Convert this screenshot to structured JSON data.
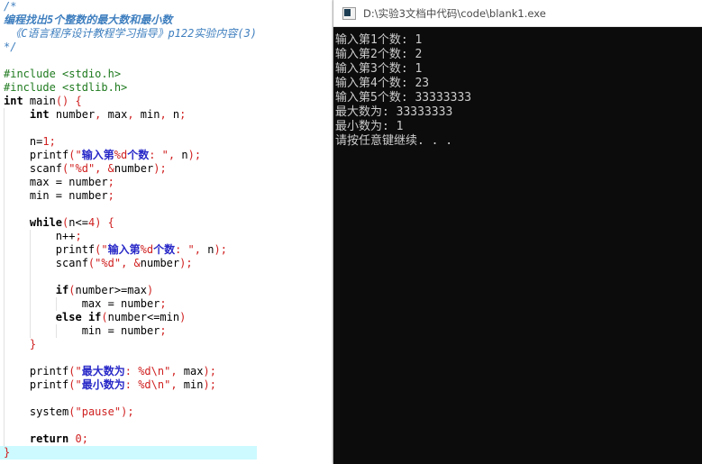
{
  "editor": {
    "language": "c",
    "highlight_color": "#ccfaff",
    "lines": [
      {
        "n": 1,
        "indent": 0,
        "tokens": [
          {
            "t": "/*",
            "c": "cmt2"
          }
        ]
      },
      {
        "n": 2,
        "indent": 0,
        "tokens": [
          {
            "t": "编程找出5个整数的最大数和最小数",
            "c": "cmt"
          }
        ]
      },
      {
        "n": 3,
        "indent": 0,
        "tokens": [
          {
            "t": " 《C语言程序设计教程学习指导》p122实验内容(3)",
            "c": "cmt2"
          }
        ]
      },
      {
        "n": 4,
        "indent": 0,
        "tokens": [
          {
            "t": "*/",
            "c": "cmt2"
          }
        ]
      },
      {
        "n": 5,
        "indent": 0,
        "tokens": []
      },
      {
        "n": 6,
        "indent": 0,
        "tokens": [
          {
            "t": "#include <stdio.h>",
            "c": "pre"
          }
        ]
      },
      {
        "n": 7,
        "indent": 0,
        "tokens": [
          {
            "t": "#include <stdlib.h>",
            "c": "pre"
          }
        ]
      },
      {
        "n": 8,
        "indent": 0,
        "tokens": [
          {
            "t": "int",
            "c": "kw"
          },
          {
            "t": " main",
            "c": "fn"
          },
          {
            "t": "()",
            "c": "op"
          },
          {
            "t": " ",
            "c": "pl"
          },
          {
            "t": "{",
            "c": "op"
          }
        ]
      },
      {
        "n": 9,
        "indent": 1,
        "tokens": [
          {
            "t": "int",
            "c": "kw"
          },
          {
            "t": " number",
            "c": "pl"
          },
          {
            "t": ",",
            "c": "sem"
          },
          {
            "t": " max",
            "c": "pl"
          },
          {
            "t": ",",
            "c": "sem"
          },
          {
            "t": " min",
            "c": "pl"
          },
          {
            "t": ",",
            "c": "sem"
          },
          {
            "t": " n",
            "c": "pl"
          },
          {
            "t": ";",
            "c": "sem"
          }
        ]
      },
      {
        "n": 10,
        "indent": 1,
        "tokens": []
      },
      {
        "n": 11,
        "indent": 1,
        "tokens": [
          {
            "t": "n=",
            "c": "pl"
          },
          {
            "t": "1",
            "c": "num"
          },
          {
            "t": ";",
            "c": "sem"
          }
        ]
      },
      {
        "n": 12,
        "indent": 1,
        "tokens": [
          {
            "t": "printf",
            "c": "fn"
          },
          {
            "t": "(",
            "c": "op"
          },
          {
            "t": "\"",
            "c": "str"
          },
          {
            "t": "输入第",
            "c": "strcn"
          },
          {
            "t": "%d",
            "c": "str"
          },
          {
            "t": "个数",
            "c": "strcn"
          },
          {
            "t": ": \"",
            "c": "str"
          },
          {
            "t": ",",
            "c": "sem"
          },
          {
            "t": " n",
            "c": "pl"
          },
          {
            "t": ")",
            "c": "op"
          },
          {
            "t": ";",
            "c": "sem"
          }
        ]
      },
      {
        "n": 13,
        "indent": 1,
        "tokens": [
          {
            "t": "scanf",
            "c": "fn"
          },
          {
            "t": "(",
            "c": "op"
          },
          {
            "t": "\"%d\"",
            "c": "str"
          },
          {
            "t": ",",
            "c": "sem"
          },
          {
            "t": " ",
            "c": "pl"
          },
          {
            "t": "&",
            "c": "op"
          },
          {
            "t": "number",
            "c": "pl"
          },
          {
            "t": ")",
            "c": "op"
          },
          {
            "t": ";",
            "c": "sem"
          }
        ]
      },
      {
        "n": 14,
        "indent": 1,
        "tokens": [
          {
            "t": "max = number",
            "c": "pl"
          },
          {
            "t": ";",
            "c": "sem"
          }
        ]
      },
      {
        "n": 15,
        "indent": 1,
        "tokens": [
          {
            "t": "min = number",
            "c": "pl"
          },
          {
            "t": ";",
            "c": "sem"
          }
        ]
      },
      {
        "n": 16,
        "indent": 1,
        "tokens": []
      },
      {
        "n": 17,
        "indent": 1,
        "tokens": [
          {
            "t": "while",
            "c": "kw"
          },
          {
            "t": "(",
            "c": "op"
          },
          {
            "t": "n<=",
            "c": "pl"
          },
          {
            "t": "4",
            "c": "num"
          },
          {
            "t": ")",
            "c": "op"
          },
          {
            "t": " ",
            "c": "pl"
          },
          {
            "t": "{",
            "c": "op"
          }
        ]
      },
      {
        "n": 18,
        "indent": 2,
        "tokens": [
          {
            "t": "n++",
            "c": "pl"
          },
          {
            "t": ";",
            "c": "sem"
          }
        ]
      },
      {
        "n": 19,
        "indent": 2,
        "tokens": [
          {
            "t": "printf",
            "c": "fn"
          },
          {
            "t": "(",
            "c": "op"
          },
          {
            "t": "\"",
            "c": "str"
          },
          {
            "t": "输入第",
            "c": "strcn"
          },
          {
            "t": "%d",
            "c": "str"
          },
          {
            "t": "个数",
            "c": "strcn"
          },
          {
            "t": ": \"",
            "c": "str"
          },
          {
            "t": ",",
            "c": "sem"
          },
          {
            "t": " n",
            "c": "pl"
          },
          {
            "t": ")",
            "c": "op"
          },
          {
            "t": ";",
            "c": "sem"
          }
        ]
      },
      {
        "n": 20,
        "indent": 2,
        "tokens": [
          {
            "t": "scanf",
            "c": "fn"
          },
          {
            "t": "(",
            "c": "op"
          },
          {
            "t": "\"%d\"",
            "c": "str"
          },
          {
            "t": ",",
            "c": "sem"
          },
          {
            "t": " ",
            "c": "pl"
          },
          {
            "t": "&",
            "c": "op"
          },
          {
            "t": "number",
            "c": "pl"
          },
          {
            "t": ")",
            "c": "op"
          },
          {
            "t": ";",
            "c": "sem"
          }
        ]
      },
      {
        "n": 21,
        "indent": 2,
        "tokens": []
      },
      {
        "n": 22,
        "indent": 2,
        "tokens": [
          {
            "t": "if",
            "c": "kw"
          },
          {
            "t": "(",
            "c": "op"
          },
          {
            "t": "number>=max",
            "c": "pl"
          },
          {
            "t": ")",
            "c": "op"
          }
        ]
      },
      {
        "n": 23,
        "indent": 3,
        "tokens": [
          {
            "t": "max = number",
            "c": "pl"
          },
          {
            "t": ";",
            "c": "sem"
          }
        ]
      },
      {
        "n": 24,
        "indent": 2,
        "tokens": [
          {
            "t": "else",
            "c": "kw"
          },
          {
            "t": " ",
            "c": "pl"
          },
          {
            "t": "if",
            "c": "kw"
          },
          {
            "t": "(",
            "c": "op"
          },
          {
            "t": "number<=min",
            "c": "pl"
          },
          {
            "t": ")",
            "c": "op"
          }
        ]
      },
      {
        "n": 25,
        "indent": 3,
        "tokens": [
          {
            "t": "min = number",
            "c": "pl"
          },
          {
            "t": ";",
            "c": "sem"
          }
        ]
      },
      {
        "n": 26,
        "indent": 1,
        "tokens": [
          {
            "t": "}",
            "c": "op"
          }
        ]
      },
      {
        "n": 27,
        "indent": 1,
        "tokens": []
      },
      {
        "n": 28,
        "indent": 1,
        "tokens": [
          {
            "t": "printf",
            "c": "fn"
          },
          {
            "t": "(",
            "c": "op"
          },
          {
            "t": "\"",
            "c": "str"
          },
          {
            "t": "最大数为",
            "c": "strcn"
          },
          {
            "t": ": %d\\n\"",
            "c": "str"
          },
          {
            "t": ",",
            "c": "sem"
          },
          {
            "t": " max",
            "c": "pl"
          },
          {
            "t": ")",
            "c": "op"
          },
          {
            "t": ";",
            "c": "sem"
          }
        ]
      },
      {
        "n": 29,
        "indent": 1,
        "tokens": [
          {
            "t": "printf",
            "c": "fn"
          },
          {
            "t": "(",
            "c": "op"
          },
          {
            "t": "\"",
            "c": "str"
          },
          {
            "t": "最小数为",
            "c": "strcn"
          },
          {
            "t": ": %d\\n\"",
            "c": "str"
          },
          {
            "t": ",",
            "c": "sem"
          },
          {
            "t": " min",
            "c": "pl"
          },
          {
            "t": ")",
            "c": "op"
          },
          {
            "t": ";",
            "c": "sem"
          }
        ]
      },
      {
        "n": 30,
        "indent": 1,
        "tokens": []
      },
      {
        "n": 31,
        "indent": 1,
        "tokens": [
          {
            "t": "system",
            "c": "fn"
          },
          {
            "t": "(",
            "c": "op"
          },
          {
            "t": "\"pause\"",
            "c": "str"
          },
          {
            "t": ")",
            "c": "op"
          },
          {
            "t": ";",
            "c": "sem"
          }
        ]
      },
      {
        "n": 32,
        "indent": 1,
        "tokens": []
      },
      {
        "n": 33,
        "indent": 1,
        "tokens": [
          {
            "t": "return",
            "c": "kw"
          },
          {
            "t": " ",
            "c": "pl"
          },
          {
            "t": "0",
            "c": "num"
          },
          {
            "t": ";",
            "c": "sem"
          }
        ]
      },
      {
        "n": 34,
        "indent": 0,
        "highlight": true,
        "tokens": [
          {
            "t": "}",
            "c": "op"
          }
        ]
      }
    ]
  },
  "console": {
    "title": "D:\\实验3文档中代码\\code\\blank1.exe",
    "icon": "console-app-icon",
    "output_lines": [
      "输入第1个数: 1",
      "输入第2个数: 2",
      "输入第3个数: 1",
      "输入第4个数: 23",
      "输入第5个数: 33333333",
      "最大数为: 33333333",
      "最小数为: 1",
      "请按任意键继续. . ."
    ]
  }
}
